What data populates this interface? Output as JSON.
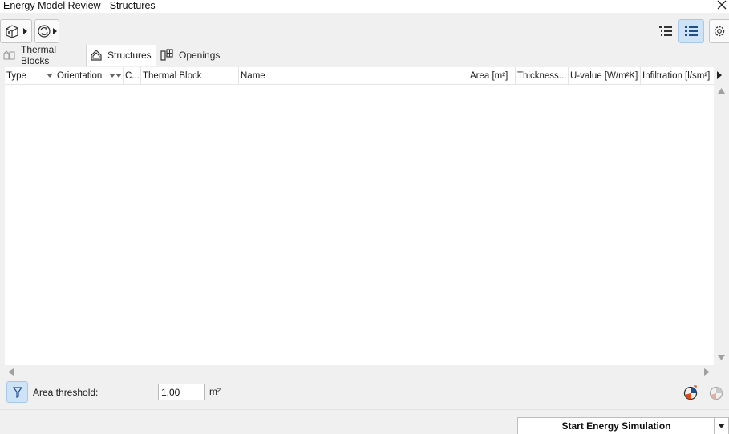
{
  "window": {
    "title": "Energy Model Review - Structures"
  },
  "toolbar": {
    "left_buttons": [
      {
        "icon": "building-model-icon"
      },
      {
        "icon": "refresh-cycle-icon"
      }
    ],
    "right_buttons": [
      {
        "icon": "tree-list-view-icon",
        "active": false
      },
      {
        "icon": "flat-list-view-icon",
        "active": true
      },
      {
        "icon": "gear-icon",
        "active": false
      }
    ]
  },
  "tabs": [
    {
      "label": "Thermal Blocks",
      "icon": "thermal-blocks-icon",
      "selected": false
    },
    {
      "label": "Structures",
      "icon": "house-outline-icon",
      "selected": true
    },
    {
      "label": "Openings",
      "icon": "openings-icon",
      "selected": false
    }
  ],
  "table": {
    "columns": [
      {
        "label": "Type",
        "sortable": true
      },
      {
        "label": "Orientation",
        "sortable": true
      },
      {
        "label": "C...",
        "sortable": false
      },
      {
        "label": "Thermal Block",
        "sortable": false
      },
      {
        "label": "Name",
        "sortable": false
      },
      {
        "label": "Area [m²]",
        "sortable": false
      },
      {
        "label": "Thickness...",
        "sortable": false
      },
      {
        "label": "U-value [W/m²K]",
        "sortable": false
      },
      {
        "label": "Infiltration [l/sm²]",
        "sortable": false
      }
    ],
    "rows": []
  },
  "footer": {
    "area_threshold_label": "Area threshold:",
    "area_threshold_value": "1,00",
    "area_threshold_unit": "m²"
  },
  "actions": {
    "start_simulation_label": "Start Energy Simulation"
  },
  "colors": {
    "accent_bg": "#cfe3f7",
    "accent_border": "#a8c8ea",
    "icon_blue": "#1f4e8c"
  }
}
